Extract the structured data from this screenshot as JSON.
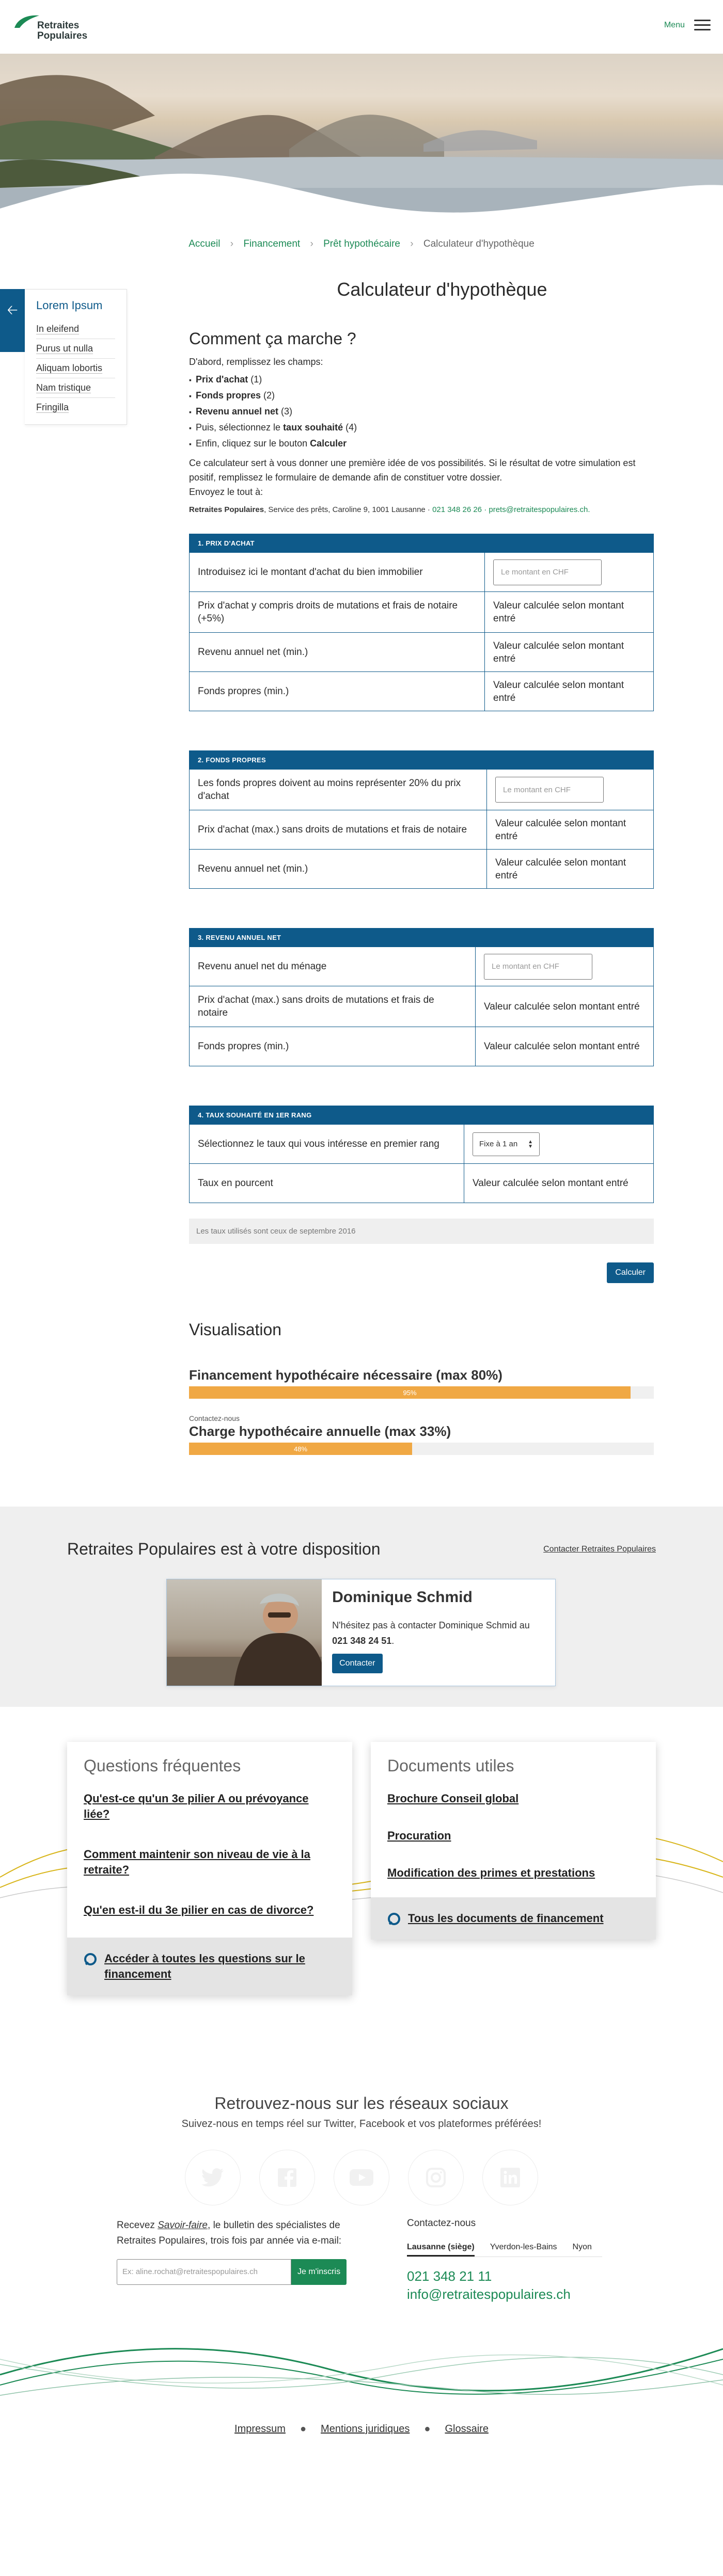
{
  "header": {
    "logo_line1": "Retraites",
    "logo_line2": "Populaires",
    "menu_label": "Menu"
  },
  "breadcrumb": {
    "items": [
      "Accueil",
      "Financement",
      "Prêt hypothécaire"
    ],
    "current": "Calculateur d'hypothèque",
    "sep": "›"
  },
  "sidenav": {
    "title": "Lorem Ipsum",
    "items": [
      "In eleifend",
      "Purus ut nulla",
      "Aliquam lobortis",
      "Nam tristique",
      "Fringilla"
    ]
  },
  "page": {
    "title": "Calculateur d'hypothèque",
    "how_title": "Comment ça marche ?",
    "intro": "D'abord, remplissez les champs:",
    "steps": [
      {
        "bold": "Prix d'achat",
        "rest": " (1)"
      },
      {
        "bold": "Fonds propres",
        "rest": " (2)"
      },
      {
        "bold": "Revenu annuel net",
        "rest": " (3)"
      },
      {
        "pre": "Puis, sélectionnez le ",
        "bold": "taux souhaité",
        "rest": " (4)"
      },
      {
        "pre": "Enfin, cliquez sur le bouton ",
        "bold": "Calculer",
        "rest": ""
      }
    ],
    "para1": "Ce calculateur sert à vous donner une première idée de vos possibilités. Si le résultat de votre simulation est positif, remplissez le formulaire de demande afin de constituer votre dossier.",
    "para2": "Envoyez le tout à:",
    "contact_org": "Retraites Populaires",
    "contact_addr": ", Service des prêts, Caroline 9, 1001 Lausanne · ",
    "contact_phone": "021 348 26 26",
    "contact_sep": " · ",
    "contact_email": "prets@retraitespopulaires.ch."
  },
  "sections": {
    "s1": {
      "head": "1. PRIX D'ACHAT",
      "rows": [
        {
          "label": "Introduisez ici le montant d'achat du bien immobilier",
          "placeholder": "Le montant en CHF"
        },
        {
          "label": "Prix d'achat y compris droits de mutations et frais de notaire (+5%)",
          "value": "Valeur calculée selon montant entré"
        },
        {
          "label": "Revenu annuel net (min.)",
          "value": "Valeur calculée selon montant entré"
        },
        {
          "label": "Fonds propres (min.)",
          "value": "Valeur calculée selon montant entré"
        }
      ]
    },
    "s2": {
      "head": "2. FONDS PROPRES",
      "rows": [
        {
          "label": "Les fonds propres doivent au moins représenter 20% du prix d'achat",
          "placeholder": "Le montant en CHF"
        },
        {
          "label": "Prix d'achat (max.) sans droits de mutations et frais de notaire",
          "value": "Valeur calculée selon montant entré"
        },
        {
          "label": "Revenu annuel net (min.)",
          "value": "Valeur calculée selon montant entré"
        }
      ]
    },
    "s3": {
      "head": "3. REVENU ANNUEL NET",
      "rows": [
        {
          "label": "Revenu anuel net du ménage",
          "placeholder": "Le montant en CHF"
        },
        {
          "label": "Prix d'achat (max.) sans droits de mutations et frais de notaire",
          "value": "Valeur calculée selon montant entré"
        },
        {
          "label": "Fonds propres (min.)",
          "value": "Valeur calculée selon montant entré"
        }
      ]
    },
    "s4": {
      "head": "4. TAUX SOUHAITÉ EN 1ER RANG",
      "rows": [
        {
          "label": "Sélectionnez le taux qui vous intéresse en premier rang",
          "select": "Fixe à 1 an"
        },
        {
          "label": "Taux en pourcent",
          "value": "Valeur calculée selon montant entré"
        }
      ]
    },
    "note": "Les taux utilisés sont ceux de septembre 2016",
    "calc_button": "Calculer"
  },
  "visualisation": {
    "title": "Visualisation",
    "bars": [
      {
        "label": "Financement hypothécaire nécessaire (max 80%)",
        "percent": 95,
        "text": "95%"
      },
      {
        "label": "Charge hypothécaire annuelle (max 33%)",
        "percent": 48,
        "text": "48%"
      }
    ],
    "contact_link": "Contactez-nous"
  },
  "contact_band": {
    "title": "Retraites Populaires est à votre disposition",
    "link": "Contacter Retraites Populaires",
    "name": "Dominique Schmid",
    "text_pre": "N'hésitez pas à contacter Dominique Schmid au ",
    "phone": "021 348 24 51",
    "text_post": ".",
    "button": "Contacter"
  },
  "faq": {
    "title": "Questions fréquentes",
    "items": [
      "Qu'est-ce qu'un 3e pilier A ou prévoyance liée?",
      "Comment maintenir son niveau de vie à la retraite?",
      "Qu'en est-il du 3e pilier en cas de divorce?"
    ],
    "footer": "Accéder à toutes les questions sur le financement"
  },
  "docs": {
    "title": "Documents utiles",
    "items": [
      "Brochure Conseil global",
      "Procuration",
      "Modification des primes et prestations"
    ],
    "footer": "Tous les documents de financement"
  },
  "social": {
    "title": "Retrouvez-nous sur les réseaux sociaux",
    "subtitle": "Suivez-nous en temps réel sur Twitter, Facebook et vos plateformes préférées!",
    "icons": [
      "twitter-icon",
      "facebook-icon",
      "youtube-icon",
      "instagram-icon",
      "linkedin-icon"
    ]
  },
  "newsletter": {
    "pre": "Recevez ",
    "em": "Savoir-faire",
    "post": ", le bulletin des spécialistes de Retraites Populaires, trois fois par année via e-mail:",
    "placeholder": "Ex: aline.rochat@retraitespopulaires.ch",
    "button": "Je m'inscris"
  },
  "contact": {
    "title": "Contactez-nous",
    "tabs": [
      "Lausanne (siège)",
      "Yverdon-les-Bains",
      "Nyon"
    ],
    "phone": "021 348 21 11",
    "email": "info@retraitespopulaires.ch"
  },
  "footer": {
    "links": [
      "Impressum",
      "Mentions juridiques",
      "Glossaire"
    ]
  },
  "colors": {
    "brand_blue": "#0e5a8a",
    "brand_green": "#1c8a55",
    "bar_orange": "#f0a844",
    "wave_yellow": "#d8b51a"
  }
}
